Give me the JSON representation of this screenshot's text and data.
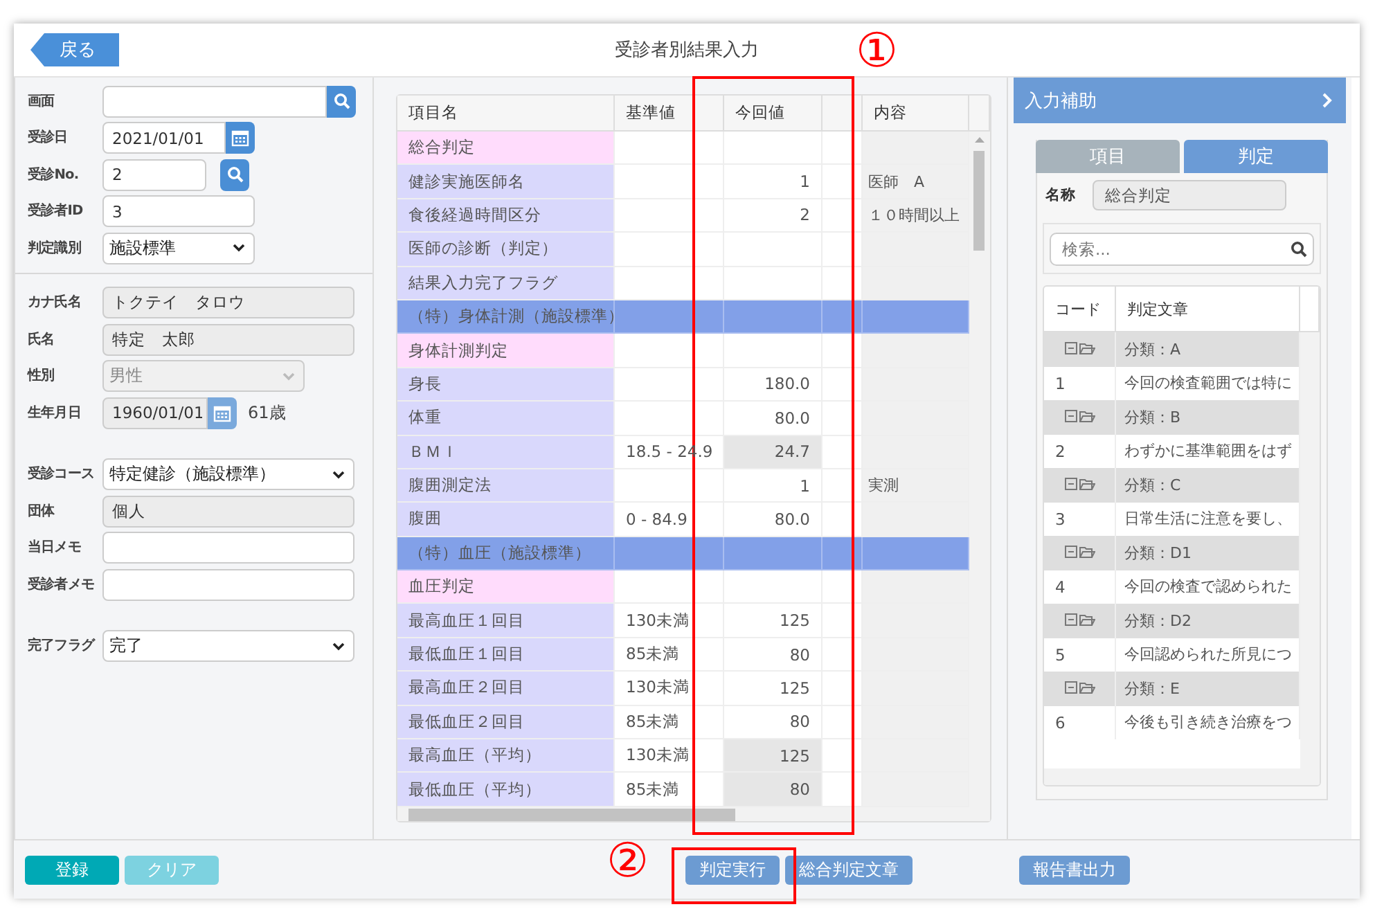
{
  "header": {
    "back_button": "戻る",
    "title": "受診者別結果入力"
  },
  "form": {
    "sections": [
      {
        "fields": [
          {
            "label": "画面",
            "kind": "search",
            "disabled": false
          },
          {
            "label": "受診日",
            "kind": "date",
            "value": "2021/01/01",
            "disabled": false
          },
          {
            "label": "受診No.",
            "kind": "lookup",
            "value": "2",
            "disabled": false
          },
          {
            "label": "受診者ID",
            "kind": "text",
            "value": "3",
            "disabled": false
          },
          {
            "label": "判定識別",
            "kind": "select",
            "value": "施設標準",
            "disabled": false
          }
        ]
      },
      {
        "fields": [
          {
            "label": "カナ氏名",
            "kind": "text",
            "value": "トクテイ　タロウ",
            "disabled": true
          },
          {
            "label": "氏名",
            "kind": "text",
            "value": "特定　太郎",
            "disabled": true
          },
          {
            "label": "性別",
            "kind": "select",
            "value": "男性",
            "disabled": true
          },
          {
            "label": "生年月日",
            "kind": "date",
            "value": "1960/01/01",
            "suffix": "61歳",
            "disabled": true
          }
        ]
      },
      {
        "fields": [
          {
            "label": "受診コース",
            "kind": "select",
            "value": "特定健診（施設標準）",
            "disabled": false
          },
          {
            "label": "団体",
            "kind": "text",
            "value": "個人",
            "disabled": true
          },
          {
            "label": "当日メモ",
            "kind": "text",
            "disabled": false
          },
          {
            "label": "受診者メモ",
            "kind": "text",
            "disabled": false
          }
        ]
      },
      {
        "fields": [
          {
            "label": "完了フラグ",
            "kind": "select",
            "value": "完了",
            "disabled": false
          }
        ]
      }
    ]
  },
  "results": {
    "columns": [
      "項目名",
      "基準値",
      "今回値",
      "内容"
    ],
    "rows": [
      {
        "kind": "judgement",
        "name": "総合判定",
        "calculated": false
      },
      {
        "kind": "item",
        "name": "健診実施医師名",
        "value": "1",
        "content": "医師　A",
        "calculated": false
      },
      {
        "kind": "item",
        "name": "食後経過時間区分",
        "value": "2",
        "content": "１０時間以上",
        "calculated": false
      },
      {
        "kind": "item",
        "name": "医師の診断（判定）",
        "calculated": false
      },
      {
        "kind": "item",
        "name": "結果入力完了フラグ",
        "calculated": false
      },
      {
        "kind": "group",
        "name": "（特）身体計測（施設標準）",
        "calculated": false
      },
      {
        "kind": "judgement",
        "name": "身体計測判定",
        "calculated": false
      },
      {
        "kind": "item",
        "name": "身長",
        "value": "180.0",
        "calculated": false
      },
      {
        "kind": "item",
        "name": "体重",
        "value": "80.0",
        "calculated": false
      },
      {
        "kind": "item",
        "name": "ＢＭＩ",
        "reference": "18.5 - 24.9",
        "value": "24.7",
        "calculated": true
      },
      {
        "kind": "item",
        "name": "腹囲測定法",
        "value": "1",
        "content": "実測",
        "calculated": false
      },
      {
        "kind": "item",
        "name": "腹囲",
        "reference": "0 - 84.9",
        "value": "80.0",
        "calculated": false
      },
      {
        "kind": "group",
        "name": "（特）血圧（施設標準）",
        "calculated": false
      },
      {
        "kind": "judgement",
        "name": "血圧判定",
        "calculated": false
      },
      {
        "kind": "item",
        "name": "最高血圧１回目",
        "reference": "130未満",
        "value": "125",
        "calculated": false
      },
      {
        "kind": "item",
        "name": "最低血圧１回目",
        "reference": "85未満",
        "value": "80",
        "calculated": false
      },
      {
        "kind": "item",
        "name": "最高血圧２回目",
        "reference": "130未満",
        "value": "125",
        "calculated": false
      },
      {
        "kind": "item",
        "name": "最低血圧２回目",
        "reference": "85未満",
        "value": "80",
        "calculated": false
      },
      {
        "kind": "item",
        "name": "最高血圧（平均）",
        "reference": "130未満",
        "value": "125",
        "calculated": true
      },
      {
        "kind": "item",
        "name": "最低血圧（平均）",
        "reference": "85未満",
        "value": "80",
        "calculated": true
      }
    ]
  },
  "assist": {
    "title": "入力補助",
    "tabs": [
      {
        "label": "項目",
        "selected": false
      },
      {
        "label": "判定",
        "selected": true
      }
    ],
    "name_label": "名称",
    "name_value": "総合判定",
    "search": {
      "placeholder": "検索..."
    },
    "columns": [
      "コード",
      "判定文章"
    ],
    "rows": [
      {
        "kind": "category",
        "text": "分類：A"
      },
      {
        "kind": "entry",
        "code": "1",
        "text": "今回の検査範囲では特に"
      },
      {
        "kind": "category",
        "text": "分類：B"
      },
      {
        "kind": "entry",
        "code": "2",
        "text": "わずかに基準範囲をはず"
      },
      {
        "kind": "category",
        "text": "分類：C"
      },
      {
        "kind": "entry",
        "code": "3",
        "text": "日常生活に注意を要し、"
      },
      {
        "kind": "category",
        "text": "分類：D1"
      },
      {
        "kind": "entry",
        "code": "4",
        "text": "今回の検査で認められた"
      },
      {
        "kind": "category",
        "text": "分類：D2"
      },
      {
        "kind": "entry",
        "code": "5",
        "text": "今回認められた所見につ"
      },
      {
        "kind": "category",
        "text": "分類：E"
      },
      {
        "kind": "entry",
        "code": "6",
        "text": "今後も引き続き治療をつ"
      }
    ]
  },
  "footer": {
    "groups": [
      [
        {
          "label": "登録",
          "kind": "primary"
        },
        {
          "label": "クリア",
          "kind": "secondary"
        }
      ],
      [
        {
          "label": "判定実行",
          "kind": "action"
        },
        {
          "label": "総合判定文章",
          "kind": "action"
        }
      ],
      [
        {
          "label": "報告書出力",
          "kind": "action"
        }
      ]
    ]
  },
  "annotations": [
    {
      "label": "①"
    },
    {
      "label": "②"
    }
  ]
}
